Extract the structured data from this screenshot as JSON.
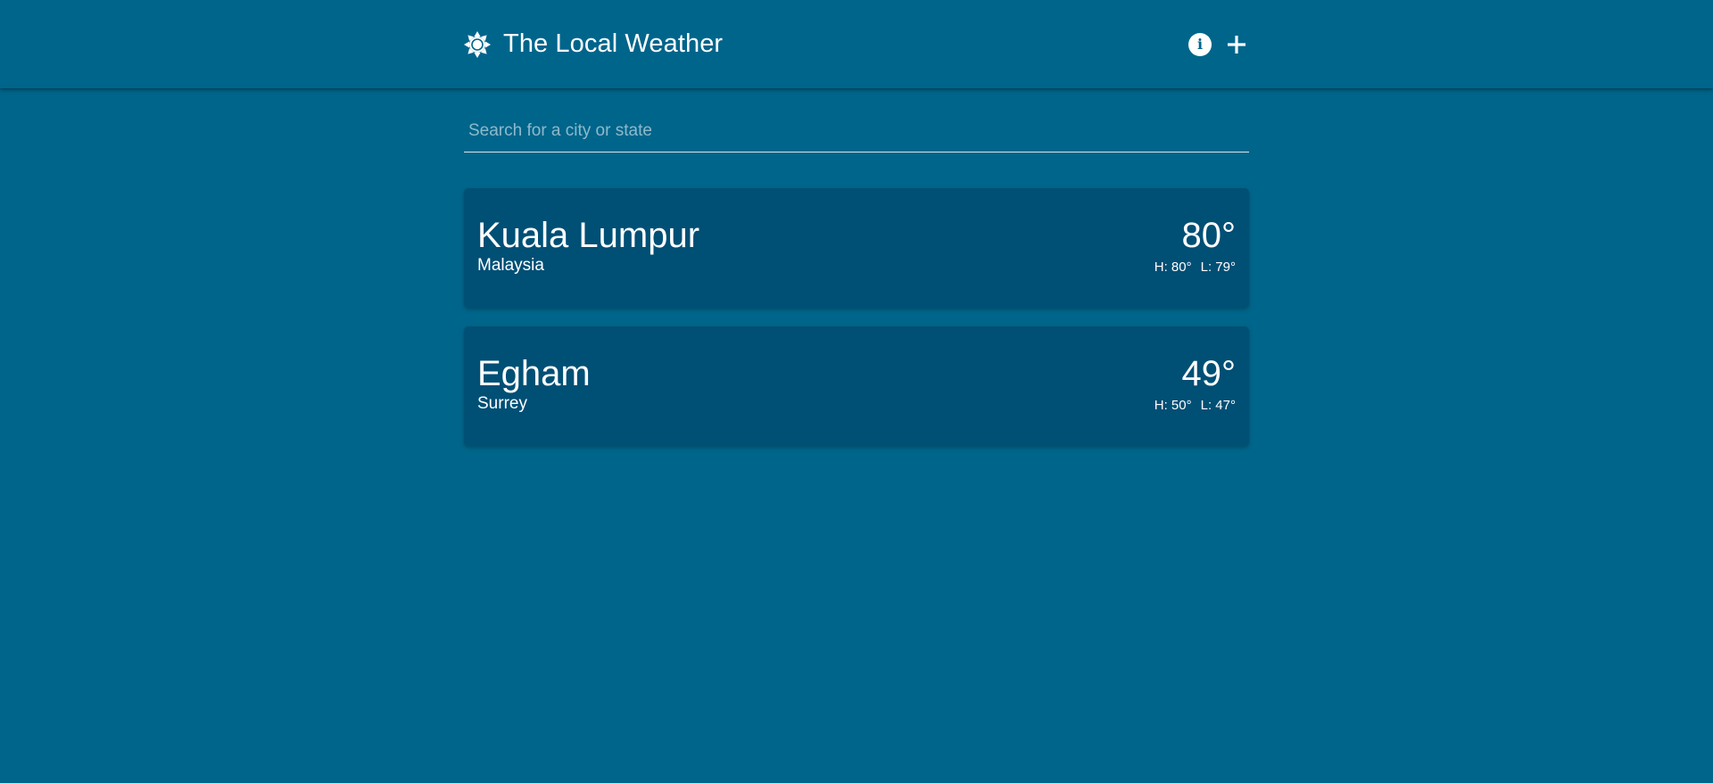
{
  "header": {
    "title": "The Local Weather",
    "logo_icon": "sun-icon",
    "actions": [
      {
        "name": "info",
        "icon": "info-icon"
      },
      {
        "name": "add",
        "icon": "plus-icon"
      }
    ]
  },
  "search": {
    "placeholder": "Search for a city or state",
    "value": ""
  },
  "locations": [
    {
      "city": "Kuala Lumpur",
      "region": "Malaysia",
      "temp": "80°",
      "high": "H: 80°",
      "low": "L: 79°"
    },
    {
      "city": "Egham",
      "region": "Surrey",
      "temp": "49°",
      "high": "H: 50°",
      "low": "L: 47°"
    }
  ],
  "colors": {
    "background": "#00658b",
    "card": "#004f75",
    "text": "#ffffff"
  }
}
